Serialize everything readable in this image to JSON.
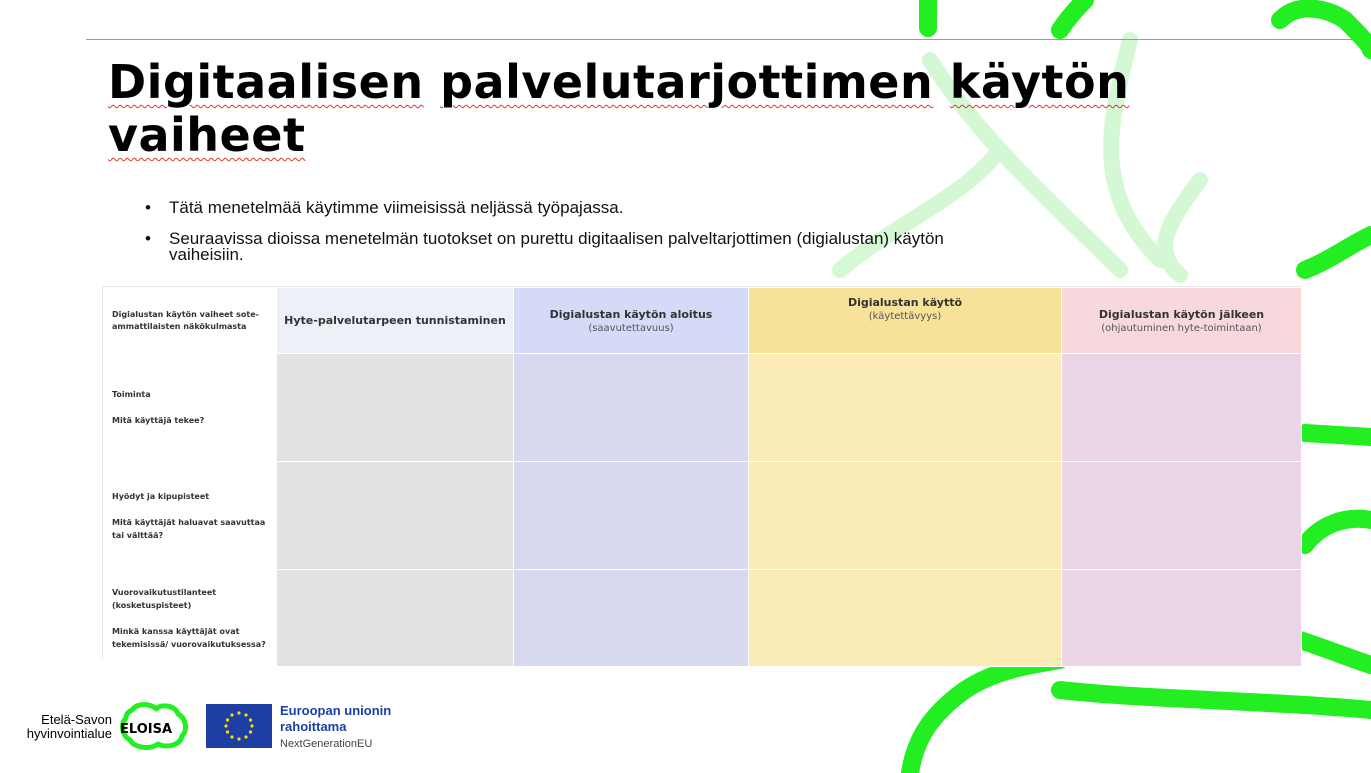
{
  "slide": {
    "title": "Digitaalisen palvelutarjottimen käytön vaiheet",
    "title_words": [
      "Digitaalisen",
      "palvelutarjottimen",
      "käytön",
      "vaiheet"
    ],
    "bullets": [
      "Tätä menetelmää käytimme viimeisissä neljässä työpajassa.",
      "Seuraavissa dioissa menetelmän tuotokset on purettu digitaalisen palveltarjottimen (digialustan) käytön vaiheisiin."
    ]
  },
  "table": {
    "corner": "Digialustan käytön vaiheet sote-ammattilaisten näkökulmasta",
    "columns": [
      {
        "title": "Hyte-palvelutarpeen tunnistaminen",
        "sub": ""
      },
      {
        "title": "Digialustan käytön aloitus",
        "sub": "(saavutettavuus)"
      },
      {
        "title": "Digialustan käyttö",
        "sub": "(käytettävyys)"
      },
      {
        "title": "Digialustan käytön jälkeen",
        "sub": "(ohjautuminen hyte-toimintaan)"
      }
    ],
    "rows": [
      {
        "label": "Toiminta",
        "question": "Mitä käyttäjä tekee?"
      },
      {
        "label": "Hyödyt ja kipupisteet",
        "question": "Mitä käyttäjät haluavat saavuttaa tai välttää?"
      },
      {
        "label": "Vuorovaikutustilanteet (kosketuspisteet)",
        "question": "Minkä kanssa käyttäjät ovat tekemisissä/ vuorovaikutuksessa?"
      }
    ],
    "colors": {
      "col1": "#e2e2e2",
      "col2": "#d7d9ee",
      "col3": "#fbecb6",
      "col4": "#ead6e7"
    }
  },
  "footer": {
    "region_line1": "Etelä-Savon",
    "region_line2": "hyvinvointialue",
    "brand": "ELOISA",
    "eu_line1": "Euroopan unionin",
    "eu_line2": "rahoittama",
    "eu_line3": "NextGenerationEU"
  },
  "accent_color": "#22ee22"
}
